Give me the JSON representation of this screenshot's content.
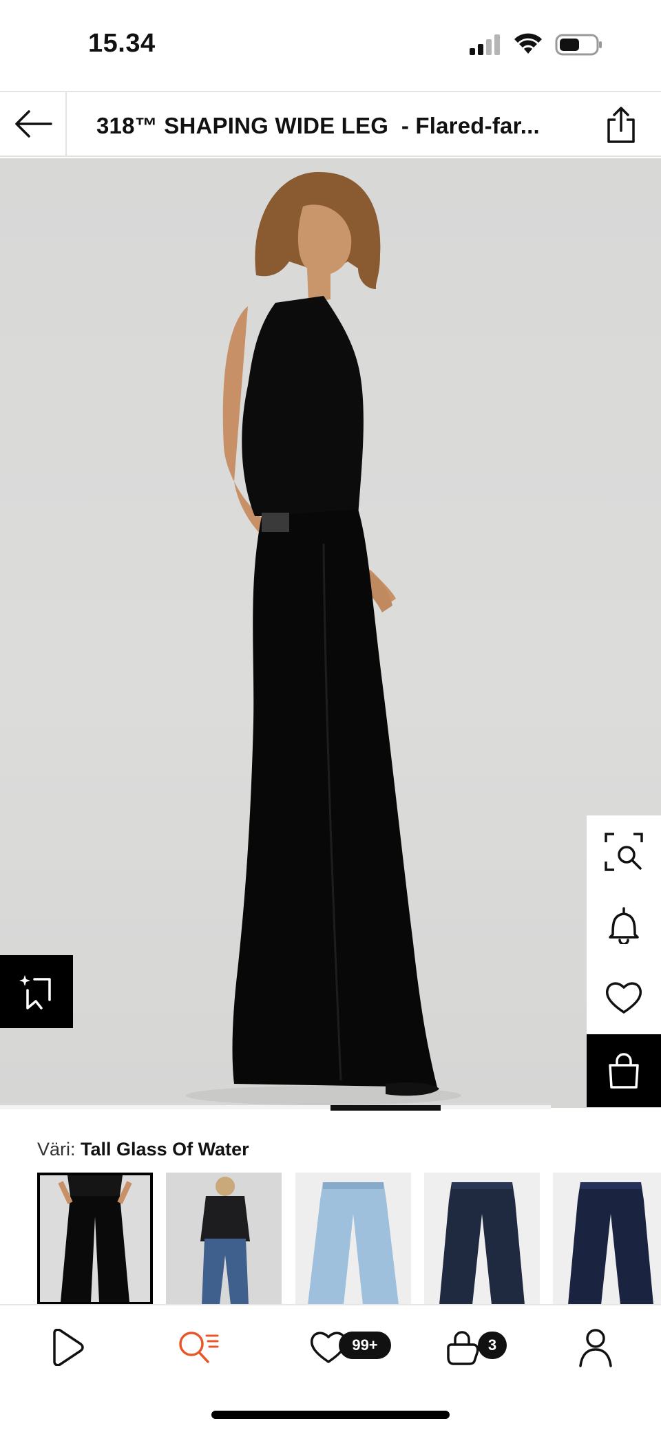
{
  "status": {
    "time": "15.34"
  },
  "header": {
    "title": "318™ SHAPING WIDE LEG  - Flared-far..."
  },
  "colors": {
    "accent": "#e8572a",
    "dark": "#000000"
  },
  "product": {
    "color_prefix": "Väri:",
    "color_name": "Tall Glass Of Water",
    "swatch_count": 5,
    "selected_swatch": 0
  },
  "actions": {
    "visual_search_icon": "visual-search-icon",
    "alert_icon": "bell-icon",
    "favorite_icon": "heart-icon",
    "cart_icon": "shopping-bag-icon",
    "ai_icon": "ai-sparkle-icon"
  },
  "tabs": [
    {
      "id": "home",
      "icon": "play-logo-icon"
    },
    {
      "id": "search",
      "icon": "search-list-icon",
      "active": true
    },
    {
      "id": "favorites",
      "icon": "heart-icon",
      "badge": "99+"
    },
    {
      "id": "cart",
      "icon": "shopping-bag-icon",
      "badge": "3"
    },
    {
      "id": "profile",
      "icon": "user-icon"
    }
  ]
}
